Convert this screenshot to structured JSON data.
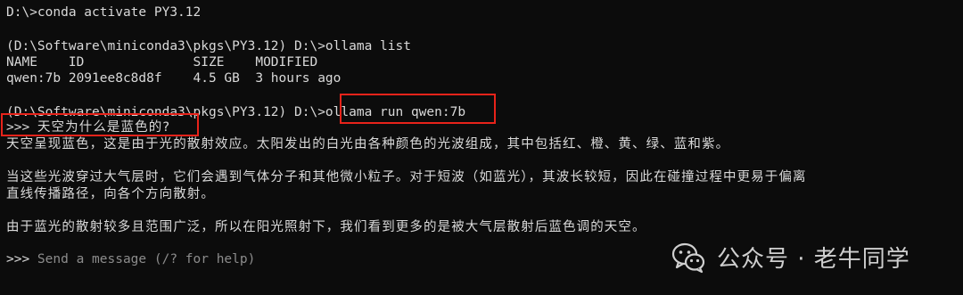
{
  "terminal": {
    "lines": {
      "activate": "D:\\>conda activate PY3.12",
      "list_cmd": "(D:\\Software\\miniconda3\\pkgs\\PY3.12) D:\\>ollama list",
      "list_header": "NAME    ID              SIZE    MODIFIED",
      "list_row": "qwen:7b 2091ee8c8d8f    4.5 GB  3 hours ago",
      "run_prompt": "(D:\\Software\\miniconda3\\pkgs\\PY3.12) D:\\>",
      "run_cmd": "ollama run qwen:7b",
      "chat_prompt": ">>> ",
      "question": "天空为什么是蓝色的?",
      "answer_1": "天空呈现蓝色，这是由于光的散射效应。太阳发出的白光由各种颜色的光波组成，其中包括红、橙、黄、绿、蓝和紫。",
      "answer_2a": "当这些光波穿过大气层时，它们会遇到气体分子和其他微小粒子。对于短波（如蓝光），其波长较短，因此在碰撞过程中更易于偏离",
      "answer_2b": "直线传播路径，向各个方向散射。",
      "answer_3": "由于蓝光的散射较多且范围广泛，所以在阳光照射下，我们看到更多的是被大气层散射后蓝色调的天空。",
      "input_prompt": ">>> ",
      "input_placeholder": "Send a message (/? for help)"
    }
  },
  "watermark": {
    "text": "公众号 · 老牛同学",
    "icon": "wechat-icon"
  },
  "colors": {
    "background": "#0c0c0c",
    "text": "#d9d9d9",
    "placeholder": "#8c8c8c",
    "highlight": "#e8231a"
  }
}
